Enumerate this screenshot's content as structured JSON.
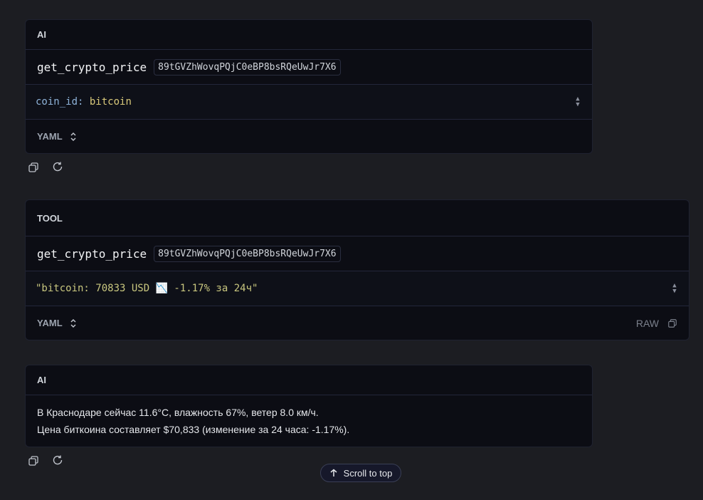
{
  "messages": [
    {
      "role": "AI",
      "tool_name": "get_crypto_price",
      "tool_id": "89tGVZhWovqPQjC0eBP8bsRQeUwJr7X6",
      "arg_key": "coin_id:",
      "arg_value": "bitcoin",
      "format_label": "YAML"
    },
    {
      "role": "TOOL",
      "tool_name": "get_crypto_price",
      "tool_id": "89tGVZhWovqPQjC0eBP8bsRQeUwJr7X6",
      "result": "\"bitcoin: 70833 USD 📉 -1.17% за 24ч\"",
      "format_label": "YAML",
      "raw_label": "RAW"
    },
    {
      "role": "AI",
      "lines": [
        "В Краснодаре сейчас 11.6°C, влажность 67%, ветер 8.0 км/ч.",
        "Цена биткоина составляет $70,833 (изменение за 24 часа: -1.17%)."
      ]
    }
  ],
  "scroll_to_top_label": "Scroll to top",
  "icons": [
    "copy-icon",
    "refresh-icon",
    "chevron-updown-icon",
    "arrow-up-icon"
  ],
  "colors": {
    "background": "#1c1d22",
    "card": "#0c0d14",
    "key": "#8fb3d9",
    "string": "#c9c77f"
  }
}
